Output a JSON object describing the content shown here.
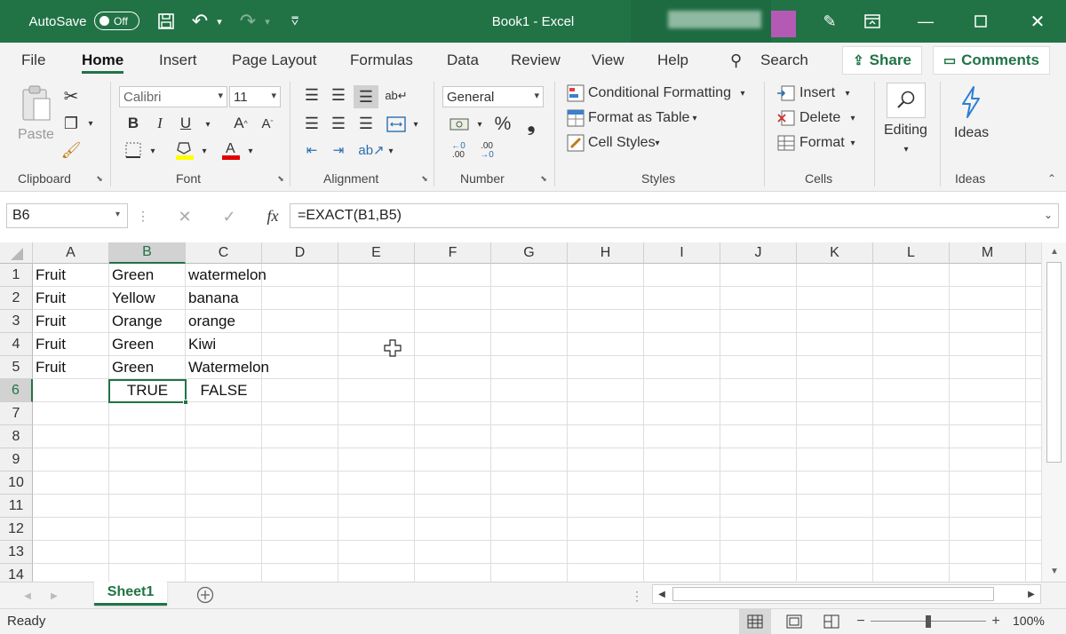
{
  "titlebar": {
    "autosave_label": "AutoSave",
    "autosave_state": "Off",
    "window_title": "Book1  -  Excel"
  },
  "menu": {
    "tabs": [
      "File",
      "Home",
      "Insert",
      "Page Layout",
      "Formulas",
      "Data",
      "Review",
      "View",
      "Help"
    ],
    "search_label": "Search",
    "share_label": "Share",
    "comments_label": "Comments"
  },
  "ribbon": {
    "clipboard": {
      "paste": "Paste",
      "group": "Clipboard"
    },
    "font": {
      "name": "Calibri",
      "size": "11",
      "bold": "B",
      "italic": "I",
      "underline": "U",
      "group": "Font"
    },
    "alignment": {
      "group": "Alignment"
    },
    "number": {
      "format": "General",
      "group": "Number"
    },
    "styles": {
      "conditional": "Conditional Formatting",
      "table": "Format as Table",
      "cell_styles": "Cell Styles",
      "group": "Styles"
    },
    "cells": {
      "insert": "Insert",
      "delete": "Delete",
      "format": "Format",
      "group": "Cells"
    },
    "editing": {
      "label": "Editing"
    },
    "ideas": {
      "label": "Ideas",
      "group": "Ideas"
    }
  },
  "formula_bar": {
    "name_box": "B6",
    "formula": "=EXACT(B1,B5)"
  },
  "grid": {
    "columns": [
      "A",
      "B",
      "C",
      "D",
      "E",
      "F",
      "G",
      "H",
      "I",
      "J",
      "K",
      "L",
      "M"
    ],
    "rows": [
      "1",
      "2",
      "3",
      "4",
      "5",
      "6",
      "7",
      "8",
      "9",
      "10",
      "11",
      "12",
      "13",
      "14"
    ],
    "cells": {
      "A1": "Fruit",
      "B1": "Green",
      "C1": "watermelon",
      "A2": "Fruit",
      "B2": "Yellow",
      "C2": "banana",
      "A3": "Fruit",
      "B3": "Orange",
      "C3": "orange",
      "A4": "Fruit",
      "B4": "Green",
      "C4": "Kiwi",
      "A5": "Fruit",
      "B5": "Green",
      "C5": "Watermelon",
      "B6": "TRUE",
      "C6": "FALSE"
    }
  },
  "sheets": {
    "active": "Sheet1"
  },
  "status": {
    "state": "Ready",
    "zoom": "100%"
  },
  "colors": {
    "accent": "#217346"
  }
}
